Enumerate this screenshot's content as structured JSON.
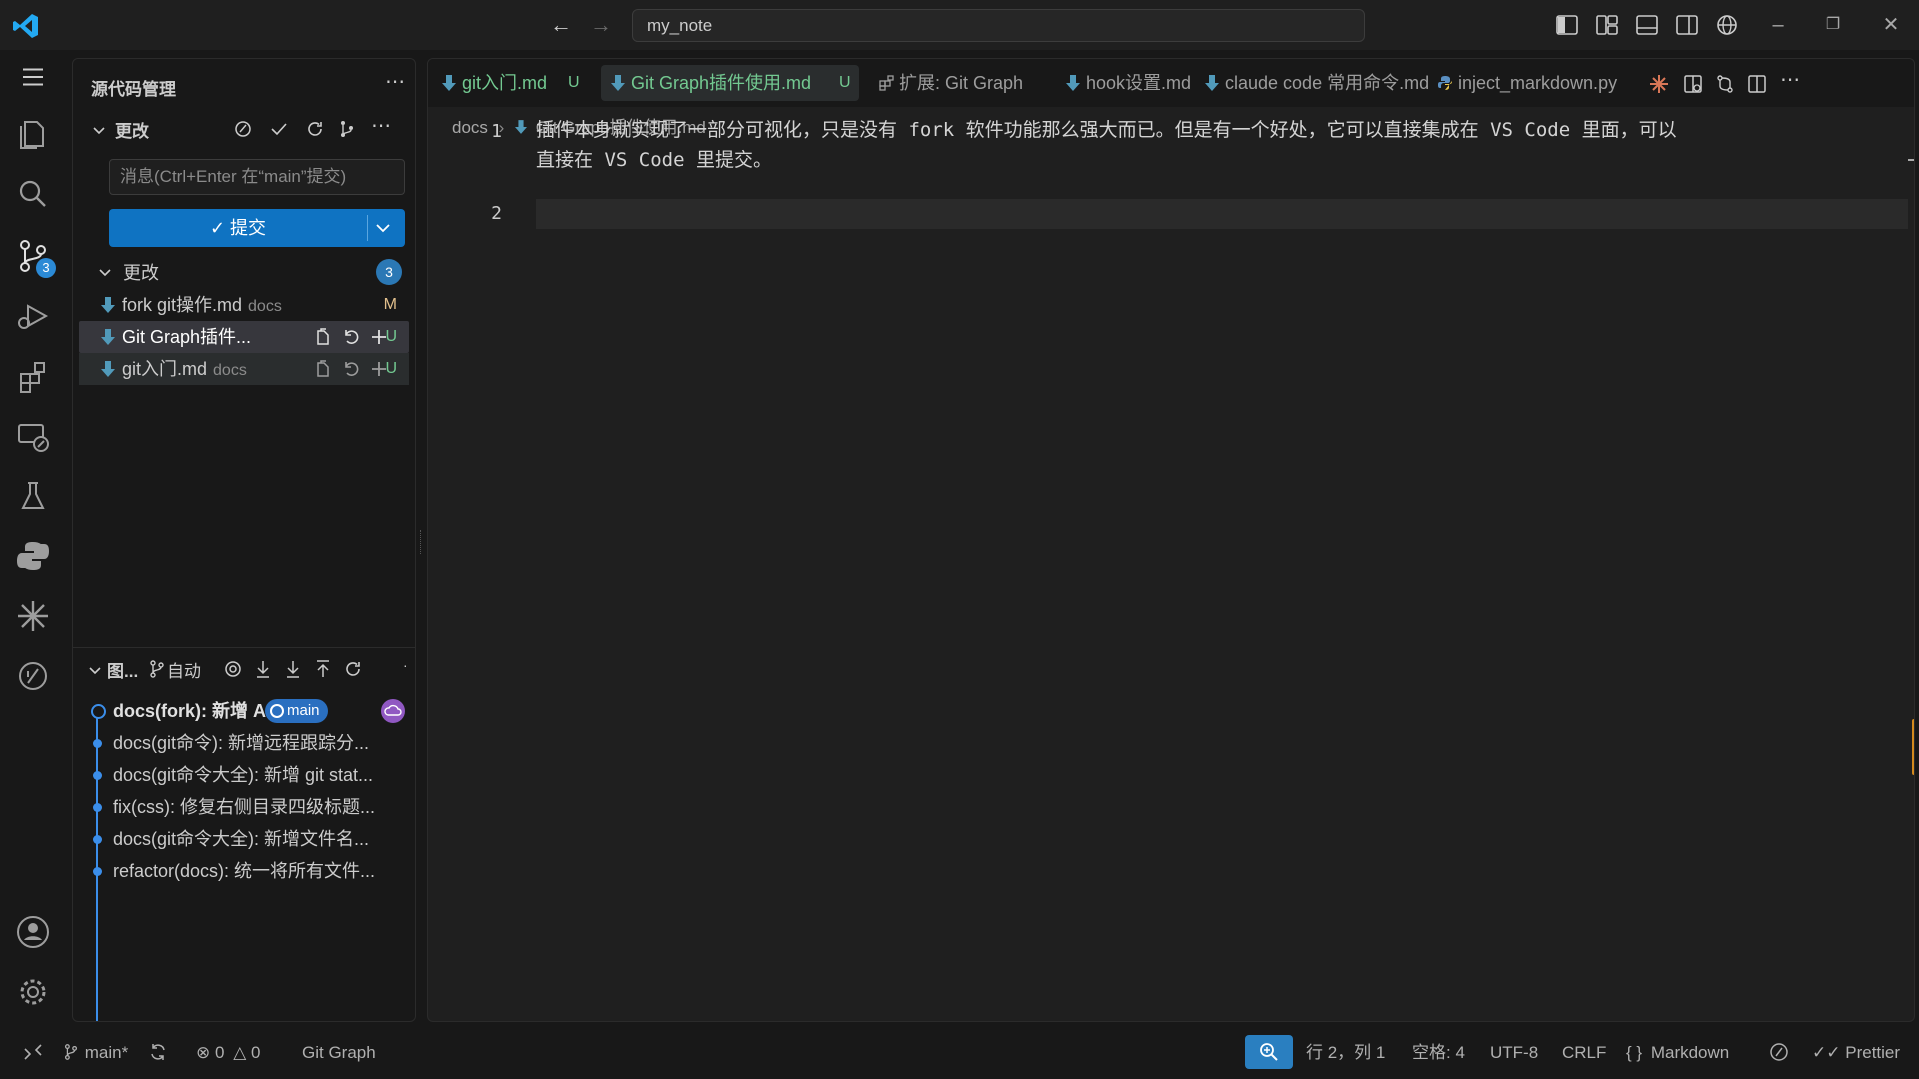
{
  "title_bar": {
    "search_value": "my_note"
  },
  "activity_bar": {
    "scm_badge": "3"
  },
  "scm": {
    "title": "源代码管理",
    "changes_header": "更改",
    "message_placeholder": "消息(Ctrl+Enter 在“main”提交)",
    "commit_label": "✓ 提交",
    "changes_group": "更改",
    "changes_count": "3",
    "files": [
      {
        "name": "fork git操作.md",
        "dir": "docs",
        "status": "M"
      },
      {
        "name": "Git Graph插件...",
        "dir": "",
        "status": "U"
      },
      {
        "name": "git入门.md",
        "dir": "docs",
        "status": "U"
      }
    ]
  },
  "graph": {
    "header": "图...",
    "auto_label": "自动",
    "branch_badge": "main",
    "commits": [
      "docs(fork): 新增 A...",
      "docs(git命令): 新增远程跟踪分...",
      "docs(git命令大全): 新增 git stat...",
      "fix(css): 修复右侧目录四级标题...",
      "docs(git命令大全): 新增文件名...",
      "refactor(docs): 统一将所有文件..."
    ]
  },
  "tabs": [
    {
      "label": "git入门.md",
      "mark": "U"
    },
    {
      "label": "Git Graph插件使用.md",
      "mark": "U"
    },
    {
      "label": "扩展: Git Graph",
      "mark": ""
    },
    {
      "label": "hook设置.md",
      "mark": ""
    },
    {
      "label": "claude code 常用命令.md",
      "mark": ""
    },
    {
      "label": "inject_markdown.py",
      "mark": ""
    }
  ],
  "breadcrumb": {
    "folder": "docs",
    "file": "Git Graph插件使用.md"
  },
  "editor": {
    "lines": [
      {
        "num": "1",
        "text_a": "插件本身就实现了一部分可视化，只是没有 fork 软件功能那么强大而已。但是有一个好处，它可以直接集成在 VS Code 里面，可以",
        "text_b": "直接在 VS Code 里提交。"
      },
      {
        "num": "2",
        "text_a": "",
        "text_b": ""
      }
    ]
  },
  "status_bar": {
    "branch": "main*",
    "errors": "0",
    "warnings": "0",
    "git_graph": "Git Graph",
    "position": "行 2，列 1",
    "spaces": "空格: 4",
    "encoding": "UTF-8",
    "eol": "CRLF",
    "language": "Markdown",
    "prettier": "Prettier"
  },
  "colors": {
    "accent": "#0f73c2",
    "untracked": "#73c991",
    "modified": "#e2c08d",
    "markdown_icon": "#519aba"
  }
}
